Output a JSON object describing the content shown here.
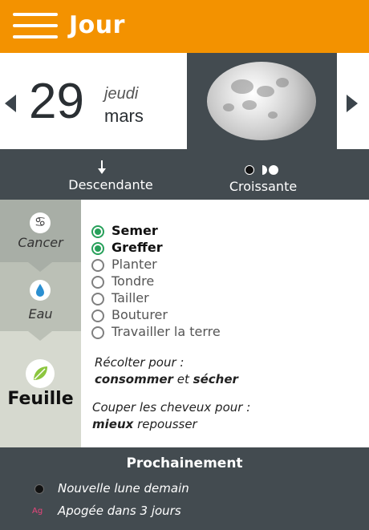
{
  "header": {
    "title": "Jour",
    "menu_icon": "hamburger-menu-icon",
    "background_color": "#f39200"
  },
  "date": {
    "day": "29",
    "weekday": "jeudi",
    "month": "mars",
    "prev_icon": "triangle-left-icon",
    "next_icon": "triangle-right-icon"
  },
  "moon": {
    "image": "full-moon-image"
  },
  "phase": {
    "direction_icon": "down-arrow-icon",
    "direction_label": "Descendante",
    "phase_icon": "moon-phase-dots-icon",
    "phase_label": "Croissante"
  },
  "sidebar": {
    "sign_icon": "cancer-zodiac-icon",
    "sign_label": "Cancer",
    "element_icon": "water-drop-icon",
    "element_label": "Eau",
    "organ_icon": "leaf-icon",
    "organ_label": "Feuille"
  },
  "activities": [
    {
      "label": "Semer",
      "checked": true
    },
    {
      "label": "Greffer",
      "checked": true
    },
    {
      "label": "Planter",
      "checked": false
    },
    {
      "label": "Tondre",
      "checked": false
    },
    {
      "label": "Tailler",
      "checked": false
    },
    {
      "label": "Bouturer",
      "checked": false
    },
    {
      "label": "Travailler la terre",
      "checked": false
    }
  ],
  "advice": {
    "harvest_intro": "Récolter pour :",
    "harvest_word1": "consommer",
    "harvest_connector": "et",
    "harvest_word2": "sécher",
    "haircut_intro": "Couper les cheveux pour :",
    "haircut_word": "mieux",
    "haircut_rest": "repousser"
  },
  "upcoming": {
    "title": "Prochainement",
    "events": [
      {
        "icon": "new-moon-dot-icon",
        "text": "Nouvelle lune demain"
      },
      {
        "icon": "apogee-icon",
        "badge": "Ag",
        "text": "Apogée dans 3 jours"
      }
    ]
  },
  "colors": {
    "accent": "#f39200",
    "dark_panel": "#434b50",
    "checked_green": "#27a05a",
    "apogee_pink": "#e8457c"
  }
}
